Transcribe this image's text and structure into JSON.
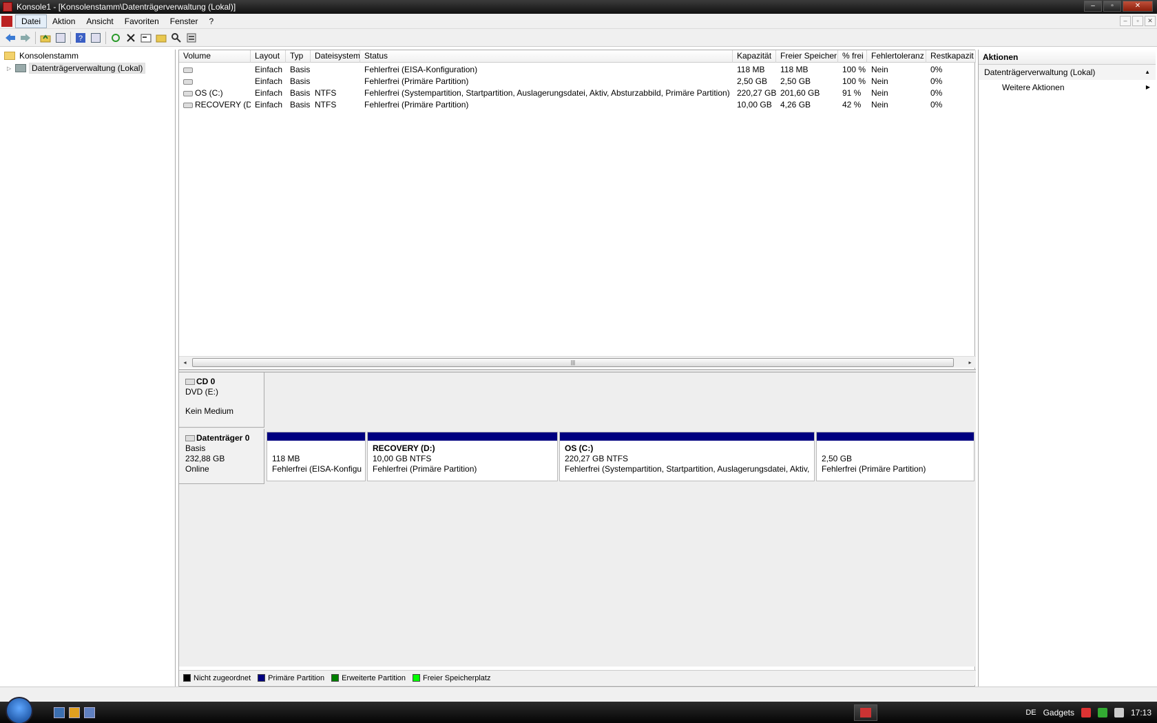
{
  "window": {
    "title": "Konsole1 - [Konsolenstamm\\Datenträgerverwaltung (Lokal)]",
    "controls": [
      "–",
      "▫",
      "✕"
    ]
  },
  "menu": {
    "items": [
      "Datei",
      "Aktion",
      "Ansicht",
      "Favoriten",
      "Fenster",
      "?"
    ],
    "mdi_controls": [
      "–",
      "▫",
      "✕"
    ]
  },
  "toolbar": {
    "icons": [
      "back-arrow-icon",
      "forward-arrow-icon",
      "up-folder-icon",
      "show-hide-tree-icon",
      "help-icon",
      "show-hide-action-pane-icon",
      "refresh-icon",
      "delete-icon",
      "properties-icon",
      "open-icon",
      "search-icon",
      "settings-icon"
    ]
  },
  "tree": {
    "root": "Konsolenstamm",
    "child": "Datenträgerverwaltung (Lokal)"
  },
  "volumes": {
    "columns": [
      "Volume",
      "Layout",
      "Typ",
      "Dateisystem",
      "Status",
      "Kapazität",
      "Freier Speicher",
      "% frei",
      "Fehlertoleranz",
      "Restkapazit"
    ],
    "rows": [
      {
        "volume": "",
        "layout": "Einfach",
        "typ": "Basis",
        "fs": "",
        "status": "Fehlerfrei (EISA-Konfiguration)",
        "kap": "118 MB",
        "frei": "118 MB",
        "pct": "100 %",
        "fehler": "Nein",
        "rest": "0%"
      },
      {
        "volume": "",
        "layout": "Einfach",
        "typ": "Basis",
        "fs": "",
        "status": "Fehlerfrei (Primäre Partition)",
        "kap": "2,50 GB",
        "frei": "2,50 GB",
        "pct": "100 %",
        "fehler": "Nein",
        "rest": "0%"
      },
      {
        "volume": "OS (C:)",
        "layout": "Einfach",
        "typ": "Basis",
        "fs": "NTFS",
        "status": "Fehlerfrei (Systempartition, Startpartition, Auslagerungsdatei, Aktiv, Absturzabbild, Primäre Partition)",
        "kap": "220,27 GB",
        "frei": "201,60 GB",
        "pct": "91 %",
        "fehler": "Nein",
        "rest": "0%"
      },
      {
        "volume": "RECOVERY (D:)",
        "layout": "Einfach",
        "typ": "Basis",
        "fs": "NTFS",
        "status": "Fehlerfrei (Primäre Partition)",
        "kap": "10,00 GB",
        "frei": "4,26 GB",
        "pct": "42 %",
        "fehler": "Nein",
        "rest": "0%"
      }
    ]
  },
  "scroll": {
    "left": "◂",
    "right": "▸",
    "grip": "|||"
  },
  "disks": {
    "cd0": {
      "name": "CD 0",
      "type": "DVD (E:)",
      "media": "Kein Medium"
    },
    "disk0": {
      "name": "Datenträger 0",
      "type": "Basis",
      "size": "232,88 GB",
      "state": "Online",
      "partitions": [
        {
          "title": "",
          "size": "118 MB",
          "status": "Fehlerfrei (EISA-Konfigu"
        },
        {
          "title": "RECOVERY  (D:)",
          "size": "10,00 GB NTFS",
          "status": "Fehlerfrei (Primäre Partition)"
        },
        {
          "title": "OS  (C:)",
          "size": "220,27 GB NTFS",
          "status": "Fehlerfrei (Systempartition, Startpartition, Auslagerungsdatei, Aktiv,"
        },
        {
          "title": "",
          "size": "2,50 GB",
          "status": "Fehlerfrei (Primäre Partition)"
        }
      ]
    }
  },
  "legend": [
    {
      "label": "Nicht zugeordnet",
      "color": "#000000"
    },
    {
      "label": "Primäre Partition",
      "color": "#000080"
    },
    {
      "label": "Erweiterte Partition",
      "color": "#008000"
    },
    {
      "label": "Freier Speicherplatz",
      "color": "#00ff00"
    }
  ],
  "actions": {
    "header": "Aktionen",
    "section": "Datenträgerverwaltung (Lokal)",
    "link": "Weitere Aktionen",
    "up_glyph": "▲",
    "more_glyph": "▶"
  },
  "taskbar": {
    "lang": "DE",
    "gadgets": "Gadgets",
    "clock": "17:13"
  }
}
